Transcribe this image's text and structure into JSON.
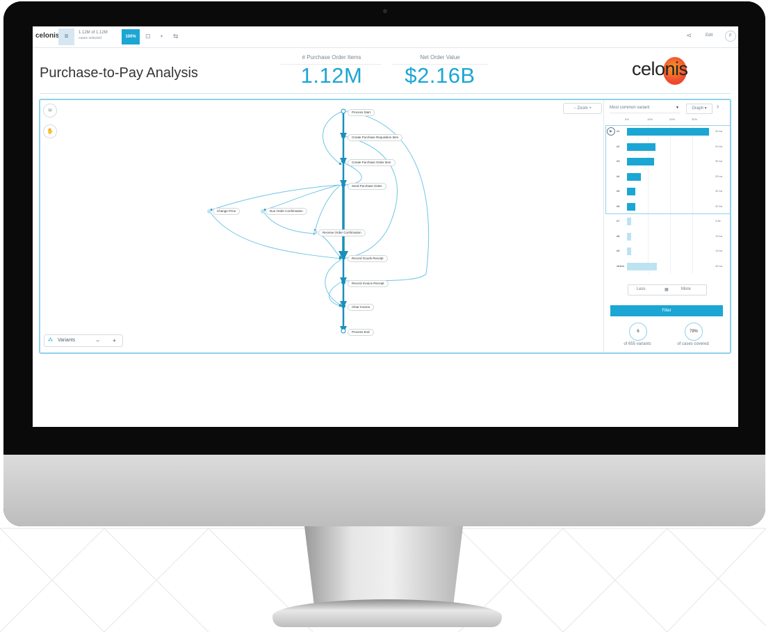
{
  "topbar": {
    "logo": "celonis",
    "cases_count": "1.12M of 1.12M",
    "cases_sub": "cases selected",
    "percent": "100%",
    "edit_label": "Edit",
    "avatar_initial": "F"
  },
  "page": {
    "title": "Purchase-to-Pay Analysis",
    "brand": "celonis"
  },
  "kpis": [
    {
      "label": "# Purchase Order Items",
      "value": "1.12M"
    },
    {
      "label": "Net Order Value",
      "value": "$2.16B"
    }
  ],
  "process_map": {
    "zoom_label": "Zoom",
    "variants_label": "Variants",
    "activities": [
      "Process Start",
      "Create Purchase Requisition Item",
      "Create Purchase Order Item",
      "Send Purchase Order",
      "Change Price",
      "Due Order Confirmation",
      "Receive Order Confirmation",
      "Record Goods Receipt",
      "Record Invoice Receipt",
      "Clear Invoice",
      "Process End"
    ]
  },
  "variant_panel": {
    "dropdown_label": "Most common variant",
    "view_label": "Graph",
    "axis_ticks": [
      "0%",
      "10%",
      "20%",
      "30%"
    ],
    "variants": [
      {
        "label": "#1",
        "share": 0.3,
        "value": "30 ba"
      },
      {
        "label": "#2",
        "share": 0.105,
        "value": "20 ba"
      },
      {
        "label": "#3",
        "share": 0.1,
        "value": "30 ba"
      },
      {
        "label": "#4",
        "share": 0.05,
        "value": "25 ba"
      },
      {
        "label": "#5",
        "share": 0.03,
        "value": "32 ba"
      },
      {
        "label": "#6",
        "share": 0.03,
        "value": "32 ba"
      },
      {
        "label": "#7",
        "share": 0.015,
        "value": "4.5b"
      },
      {
        "label": "#8",
        "share": 0.015,
        "value": "13 ba"
      },
      {
        "label": "#9",
        "share": 0.015,
        "value": "13 ba"
      },
      {
        "label": "others",
        "share": 0.11,
        "value": "34 ba"
      }
    ],
    "less_label": "Less",
    "more_label": "More",
    "filter_label": "Filter",
    "variants_count": "6",
    "variants_caption": "of 655 variants",
    "coverage": "79%",
    "coverage_caption": "of cases covered"
  },
  "colors": {
    "accent": "#1ba6d3",
    "brand_orange": "#ef4423"
  }
}
